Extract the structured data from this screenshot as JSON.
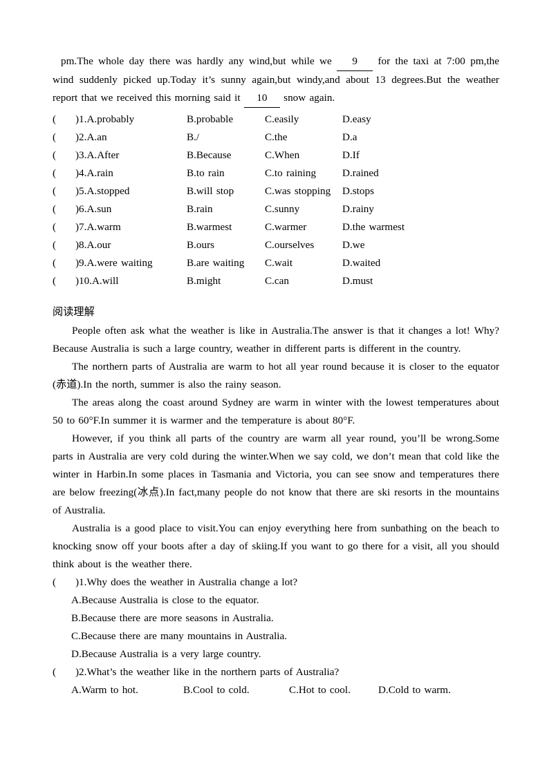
{
  "cloze": {
    "paragraph_part1": "pm.The whole day there was hardly any wind,but while we",
    "blank_9": "9",
    "paragraph_part2": "for the taxi at 7:00 pm,the wind suddenly picked up.Today it’s sunny again,but windy,and about 13 degrees.But the weather report that we received this morning said it",
    "blank_10": "10",
    "paragraph_part3": "snow again.",
    "options": [
      {
        "paren": "(",
        "a": ")1.A.probably",
        "b": "B.probable",
        "c": "C.easily",
        "d": "D.easy"
      },
      {
        "paren": "(",
        "a": ")2.A.an",
        "b": "B./",
        "c": "C.the",
        "d": "D.a"
      },
      {
        "paren": "(",
        "a": ")3.A.After",
        "b": "B.Because",
        "c": "C.When",
        "d": "D.If"
      },
      {
        "paren": "(",
        "a": ")4.A.rain",
        "b": "B.to rain",
        "c": "C.to raining",
        "d": "D.rained"
      },
      {
        "paren": "(",
        "a": ")5.A.stopped",
        "b": "B.will stop",
        "c": "C.was stopping",
        "d": "D.stops"
      },
      {
        "paren": "(",
        "a": ")6.A.sun",
        "b": "B.rain",
        "c": "C.sunny",
        "d": "D.rainy"
      },
      {
        "paren": "(",
        "a": ")7.A.warm",
        "b": "B.warmest",
        "c": "C.warmer",
        "d": "D.the warmest"
      },
      {
        "paren": "(",
        "a": ")8.A.our",
        "b": "B.ours",
        "c": "C.ourselves",
        "d": "D.we"
      },
      {
        "paren": "(",
        "a": ")9.A.were waiting",
        "b": "B.are waiting",
        "c": "C.wait",
        "d": "D.waited"
      },
      {
        "paren": "(",
        "a": ")10.A.will",
        "b": "B.might",
        "c": "C.can",
        "d": "D.must"
      }
    ]
  },
  "reading": {
    "heading": "阅读理解",
    "paragraphs": [
      "People often ask what the weather is like in Australia.The answer is that it changes a lot! Why? Because Australia is such a large country, weather in different parts is different in the country.",
      "The northern parts of Australia are warm to hot all year round because it is closer to the equator (赤道).In the north, summer is also the rainy season.",
      "The areas along the coast around Sydney are warm in winter with the lowest temperatures about 50 to 60°F.In summer it is warmer and the temperature is about 80°F.",
      "However, if you think all parts of the country are warm all year round, you’ll be wrong.Some parts in Australia are very cold during the winter.When we say cold, we don’t mean that cold like the winter in Harbin.In some places in Tasmania and Victoria, you can see snow and temperatures there are below freezing(冰点).In fact,many people do not know that there are ski resorts in the mountains of Australia.",
      "Australia is a good place to visit.You can enjoy everything here from sunbathing on the beach to knocking snow off your boots after a day of skiing.If you want to go there for a visit, all you should think about is the weather there."
    ],
    "questions": [
      {
        "paren": "(",
        "stem": ")1.Why does the weather in Australia change a lot?",
        "layout": "stacked",
        "choices": [
          "A.Because Australia is close to the equator.",
          "B.Because there are more seasons in Australia.",
          "C.Because there are many mountains in Australia.",
          "D.Because Australia is a very large country."
        ]
      },
      {
        "paren": "(",
        "stem": ")2.What’s the weather like in the northern parts of Australia?",
        "layout": "inline",
        "choices": [
          "A.Warm to hot.",
          "B.Cool to cold.",
          "C.Hot to cool.",
          "D.Cold to warm."
        ]
      }
    ]
  }
}
